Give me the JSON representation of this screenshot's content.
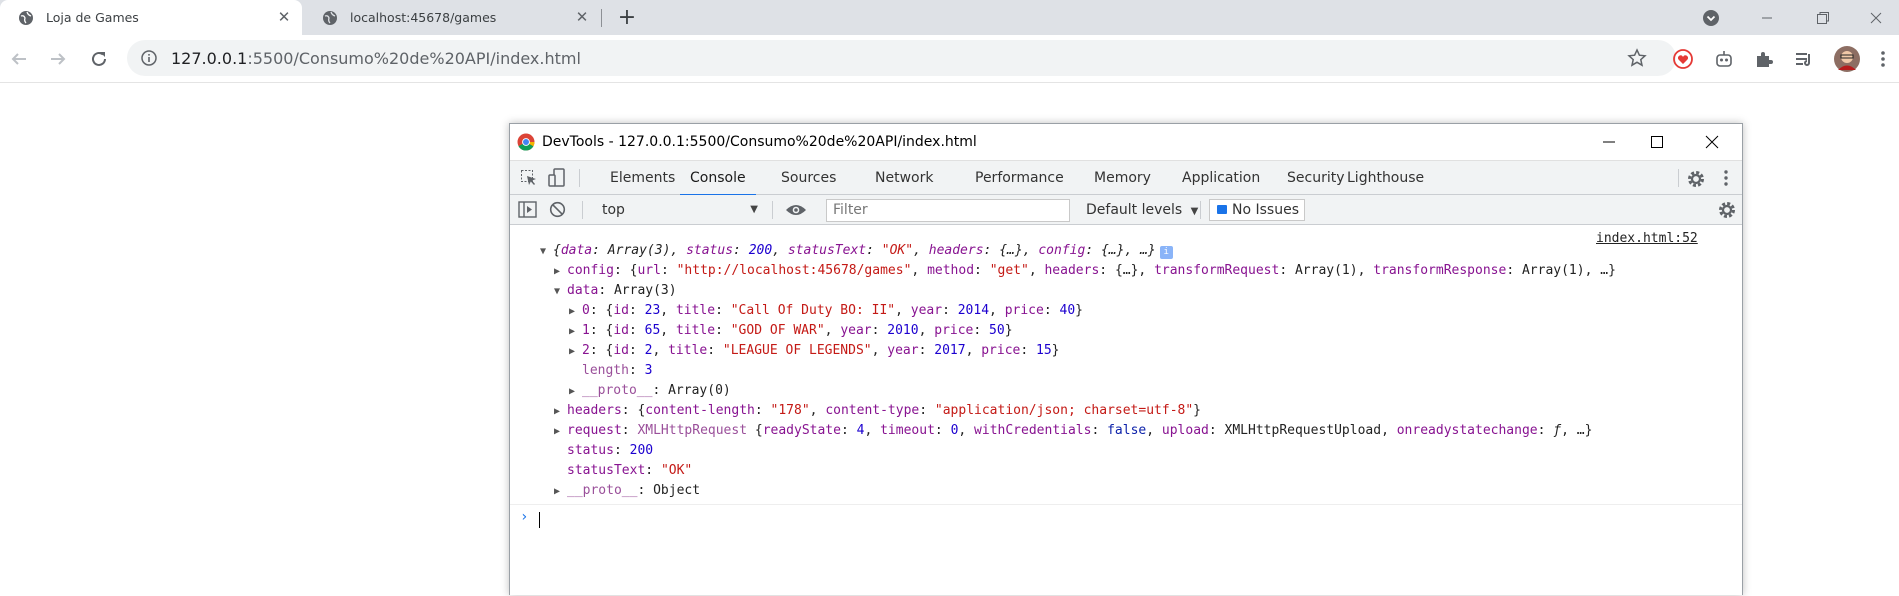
{
  "browser": {
    "tabs": [
      {
        "title": "Loja de Games",
        "active": true
      },
      {
        "title": "localhost:45678/games",
        "active": false
      }
    ],
    "address": {
      "host": "127.0.0.1",
      "path": ":5500/Consumo%20de%20API/index.html"
    }
  },
  "devtools": {
    "title": "DevTools - 127.0.0.1:5500/Consumo%20de%20API/index.html",
    "tabs": [
      "Elements",
      "Console",
      "Sources",
      "Network",
      "Performance",
      "Memory",
      "Application",
      "Security",
      "Lighthouse"
    ],
    "active_tab": "Console",
    "context": "top",
    "filter_placeholder": "Filter",
    "levels": "Default levels",
    "issues": "No Issues",
    "source_link": "index.html:52"
  },
  "console": {
    "summary": {
      "data": "Array(3)",
      "status": "200",
      "statusText": "\"OK\"",
      "headers": "{…}",
      "config": "{…}"
    },
    "config": {
      "url": "\"http://localhost:45678/games\"",
      "method": "\"get\"",
      "headers": "{…}",
      "transformRequest": "Array(1)",
      "transformResponse": "Array(1)"
    },
    "data_label": "Array(3)",
    "items": [
      {
        "index": "0",
        "id": "23",
        "title": "\"Call Of Duty BO: II\"",
        "year": "2014",
        "price": "40"
      },
      {
        "index": "1",
        "id": "65",
        "title": "\"GOD OF WAR\"",
        "year": "2010",
        "price": "50"
      },
      {
        "index": "2",
        "id": "2",
        "title": "\"LEAGUE OF LEGENDS\"",
        "year": "2017",
        "price": "15"
      }
    ],
    "length": "3",
    "data_proto": "Array(0)",
    "headers": {
      "content_length": "\"178\"",
      "content_type": "\"application/json; charset=utf-8\""
    },
    "request": {
      "type": "XMLHttpRequest",
      "readyState": "4",
      "timeout": "0",
      "withCredentials": "false",
      "upload": "XMLHttpRequestUpload"
    },
    "status": "200",
    "statusText": "\"OK\"",
    "proto": "Object"
  }
}
